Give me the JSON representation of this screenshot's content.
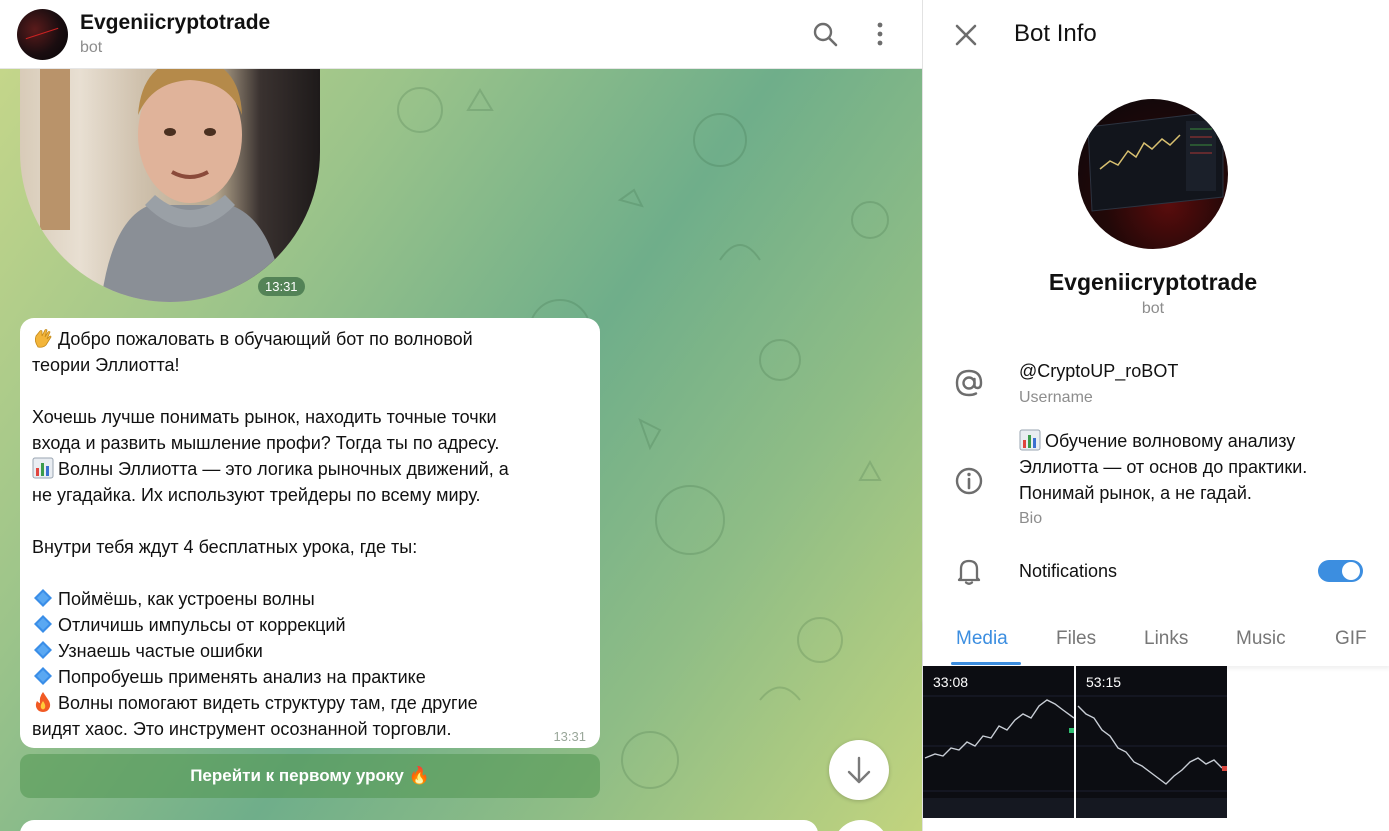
{
  "chat": {
    "title": "Evgeniicryptotrade",
    "subtitle": "bot",
    "video_time": "13:31",
    "message": {
      "lines": [
        "Добро пожаловать в обучающий бот по волновой",
        "теории Эллиотта!",
        "",
        "Хочешь лучше понимать рынок, находить точные точки",
        "входа и развить мышление профи? Тогда ты по адресу.",
        "Волны Эллиотта — это логика рыночных движений, а",
        "не угадайка. Их используют трейдеры по всему миру.",
        "",
        "Внутри тебя ждут 4 бесплатных урока, где ты:",
        "",
        "Поймёшь, как устроены волны",
        "Отличишь импульсы от коррекций",
        "Узнаешь частые ошибки",
        "Попробуешь применять анализ на практике",
        "Волны помогают видеть структуру там, где другие",
        "видят хаос. Это инструмент осознанной торговли."
      ],
      "time": "13:31"
    },
    "keyboard_button": "Перейти к первому уроку 🔥"
  },
  "panel": {
    "title": "Bot Info",
    "name": "Evgeniicryptotrade",
    "subtitle": "bot",
    "username": "@CryptoUP_roBOT",
    "username_label": "Username",
    "bio_lines": [
      "Обучение волновому анализу",
      "Эллиотта — от основ до практики.",
      "Понимай рынок, а не гадай."
    ],
    "bio_label": "Bio",
    "notifications_label": "Notifications",
    "notifications_on": true,
    "tabs": [
      "Media",
      "Files",
      "Links",
      "Music",
      "GIF"
    ],
    "active_tab": "Media",
    "media": [
      {
        "duration": "33:08"
      },
      {
        "duration": "53:15"
      }
    ]
  },
  "colors": {
    "accent": "#3c8ee0",
    "keyboard_button_bg": "#6aa86a"
  }
}
